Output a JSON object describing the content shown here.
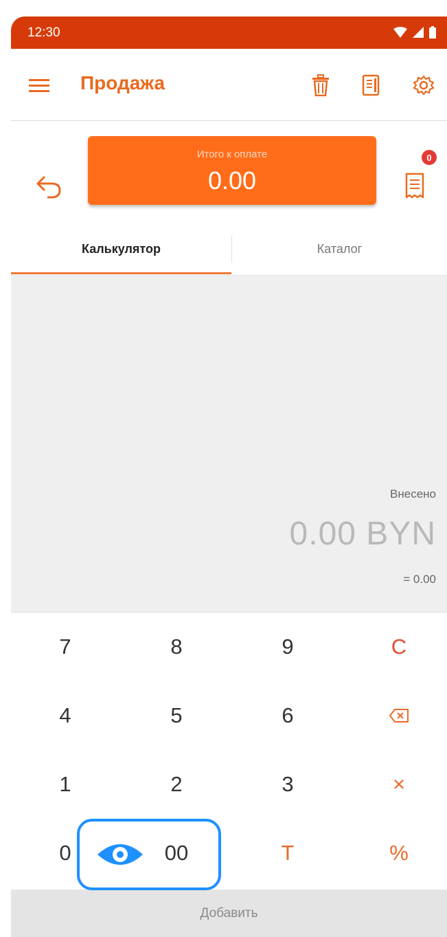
{
  "status_bar": {
    "time": "12:30"
  },
  "appbar": {
    "title": "Продажа",
    "icons": [
      "menu-icon",
      "trash-icon",
      "receipt-icon",
      "gear-icon"
    ]
  },
  "total": {
    "label": "Итого к оплате",
    "amount": "0.00",
    "badge_count": "0"
  },
  "tabs": [
    {
      "label": "Калькулятор",
      "active": true
    },
    {
      "label": "Каталог",
      "active": false
    }
  ],
  "display": {
    "paid_label": "Внесено",
    "paid_amount": "0.00 BYN",
    "equals": "= 0.00"
  },
  "keypad": {
    "rows": [
      [
        "7",
        "8",
        "9",
        "C"
      ],
      [
        "4",
        "5",
        "6",
        "backspace-icon"
      ],
      [
        "1",
        "2",
        "3",
        "×"
      ],
      [
        "0",
        "00",
        "T",
        "%"
      ]
    ]
  },
  "add_button": "Добавить",
  "overlay": {
    "icon": "eye-icon",
    "color": "#1e90ff"
  },
  "colors": {
    "status_bar": "#d63a09",
    "accent": "#ff6d1a",
    "text_accent": "#e96a1f"
  }
}
